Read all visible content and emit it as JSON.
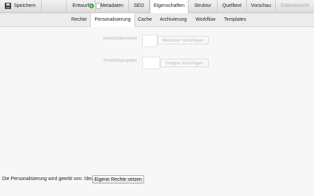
{
  "toolbar": {
    "save_label": "Speichern",
    "tabs": [
      "Entwurf",
      "Metadaten",
      "SEO",
      "Eigenschaften",
      "Struktur",
      "Quelltext",
      "Vorschau",
      "Editoransicht"
    ]
  },
  "subtabs": [
    "Rechte",
    "Personalisierung",
    "Cache",
    "Archivierung",
    "Workflow",
    "Templates"
  ],
  "personalization": {
    "users_label": "Ansichtsbenutzer",
    "add_user_button": "Benutzer hinzufügen",
    "groups_label": "Ansichtsgruppen",
    "add_group_button": "Gruppe hinzufügen"
  },
  "footer": {
    "inherited_text": "Die Personalisierung wird geerbt von: /dev",
    "own_rights_button": "Eigene Rechte setzen"
  },
  "colors": {
    "active_tab": "#ffffff",
    "toolbar_bg": "#e2e2e2",
    "content_bg": "#f7f7f7"
  }
}
